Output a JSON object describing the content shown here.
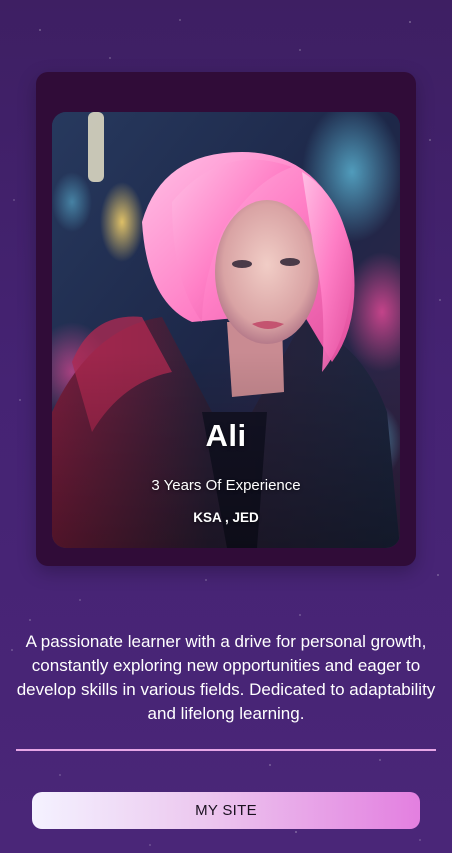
{
  "profile": {
    "name": "Ali",
    "experience": "3 Years Of Experience",
    "location": "KSA , JED",
    "photo": "portrait-pink-haired-woman-neon-city"
  },
  "bio": {
    "text": "A passionate learner with a drive for personal growth, constantly exploring new opportunities and eager to develop skills in various fields. Dedicated to adaptability and lifelong learning."
  },
  "actions": {
    "site_button_label": "MY SITE"
  },
  "colors": {
    "background": "#452373",
    "card_frame": "#300c38",
    "divider": "#e6a6e6",
    "button_gradient_start": "#f4f2ff",
    "button_gradient_end": "#e37fe0"
  }
}
